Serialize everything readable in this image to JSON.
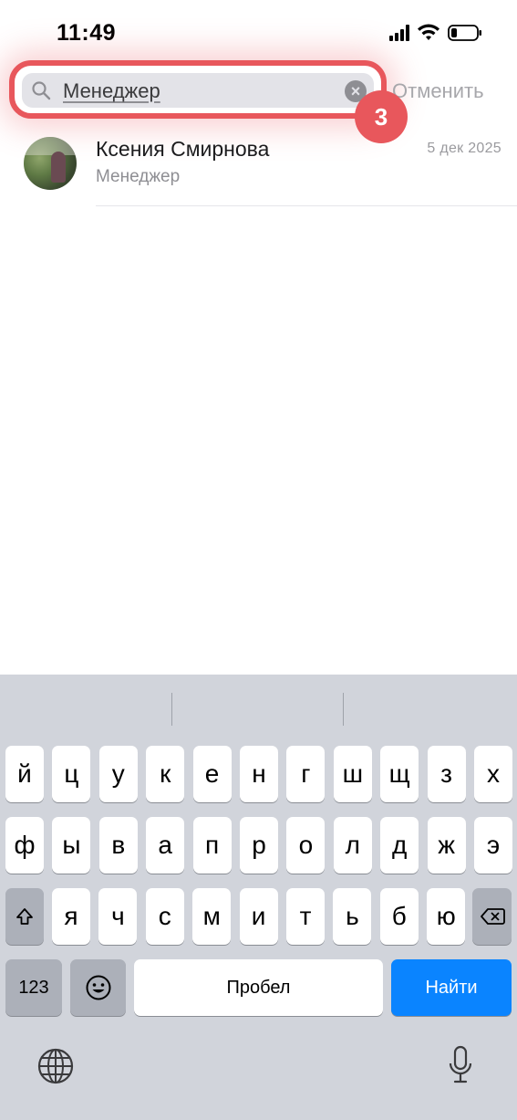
{
  "status": {
    "time": "11:49"
  },
  "search": {
    "query": "Менеджер",
    "cancel_label": "Отменить",
    "step_number": "3"
  },
  "result": {
    "name": "Ксения Смирнова",
    "subtitle": "Менеджер",
    "date": "5 дек 2025"
  },
  "keyboard": {
    "row1": [
      "й",
      "ц",
      "у",
      "к",
      "е",
      "н",
      "г",
      "ш",
      "щ",
      "з",
      "х"
    ],
    "row2": [
      "ф",
      "ы",
      "в",
      "а",
      "п",
      "р",
      "о",
      "л",
      "д",
      "ж",
      "э"
    ],
    "row3": [
      "я",
      "ч",
      "с",
      "м",
      "и",
      "т",
      "ь",
      "б",
      "ю"
    ],
    "numbers_label": "123",
    "space_label": "Пробел",
    "search_label": "Найти"
  },
  "colors": {
    "accent": "#e8575c",
    "blue": "#0a84ff",
    "keyboard_bg": "#d1d4db"
  },
  "icons": [
    "signal-icon",
    "wifi-icon",
    "battery-icon",
    "search-icon",
    "clear-icon",
    "shift-icon",
    "backspace-icon",
    "emoji-icon",
    "globe-icon",
    "microphone-icon"
  ]
}
